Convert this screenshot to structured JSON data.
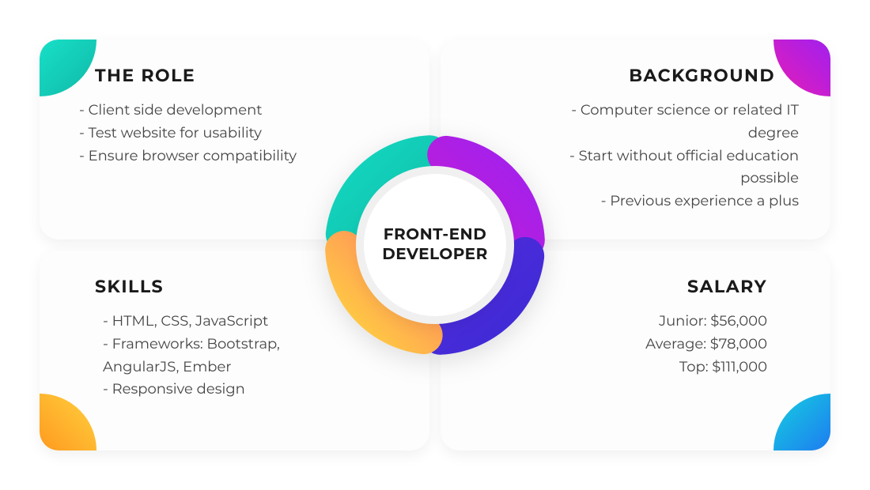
{
  "center_label": "FRONT-END DEVELOPER",
  "cards": {
    "role": {
      "title": "THE ROLE",
      "items": [
        "Client side development",
        "Test website for usability",
        "Ensure browser compatibility"
      ]
    },
    "background": {
      "title": "BACKGROUND",
      "items": [
        "Computer science or related IT degree",
        "Start without official education possible",
        "Previous experience a plus"
      ]
    },
    "skills": {
      "title": "SKILLS",
      "items": [
        "HTML, CSS, JavaScript",
        "Frameworks: Bootstrap, AngularJS, Ember",
        "Responsive design"
      ]
    },
    "salary": {
      "title": "SALARY",
      "items": [
        "Junior: $56,000",
        "Average: $78,000",
        "Top: $111,000"
      ]
    }
  },
  "colors": {
    "arc_teal_a": "#13d7c0",
    "arc_teal_b": "#0d9f8e",
    "arc_magenta_a": "#e81cb5",
    "arc_magenta_b": "#a020ef",
    "arc_orange_a": "#ffd23f",
    "arc_orange_b": "#ff2e87",
    "arc_indigo_a": "#3d2bd6",
    "arc_indigo_b": "#6b2adf"
  }
}
